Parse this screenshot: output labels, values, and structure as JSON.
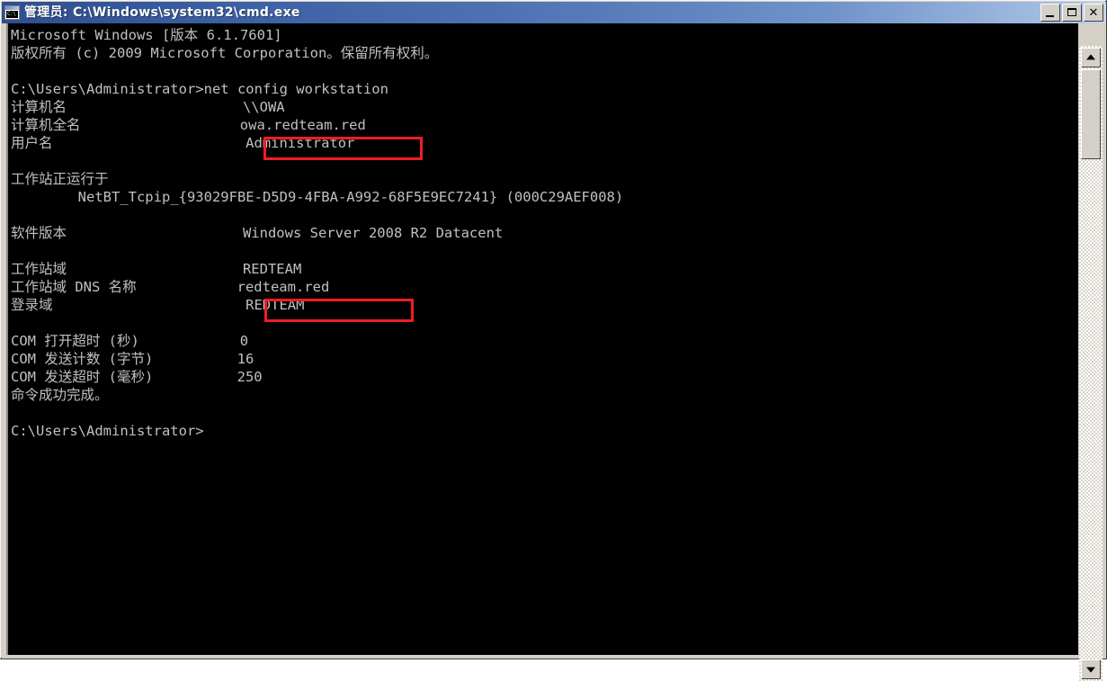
{
  "window": {
    "title": "管理员: C:\\Windows\\system32\\cmd.exe",
    "icon_name": "cmd-console-icon",
    "icon_text": "C:\\",
    "buttons": {
      "minimize": "_",
      "maximize": "□",
      "close": "✕"
    }
  },
  "colors": {
    "title_gradient_start": "#2e4e8f",
    "title_gradient_end": "#c7d6eb",
    "console_bg": "#000000",
    "console_fg": "#c0c0c0",
    "frame": "#d4d0c8",
    "highlight_red": "#f01c24"
  },
  "console": {
    "lines": [
      "Microsoft Windows [版本 6.1.7601]",
      "版权所有 (c) 2009 Microsoft Corporation。保留所有权利。",
      "",
      "C:\\Users\\Administrator>net config workstation",
      "计算机名                     \\\\OWA",
      "计算机全名                   owa.redteam.red",
      "用户名                       Administrator",
      "",
      "工作站正运行于",
      "        NetBT_Tcpip_{93029FBE-D5D9-4FBA-A992-68F5E9EC7241} (000C29AEF008)",
      "",
      "软件版本                     Windows Server 2008 R2 Datacent",
      "",
      "工作站域                     REDTEAM",
      "工作站域 DNS 名称            redteam.red",
      "登录域                       REDTEAM",
      "",
      "COM 打开超时 (秒)            0",
      "COM 发送计数 (字节)          16",
      "COM 发送超时 (毫秒)          250",
      "命令成功完成。",
      "",
      "C:\\Users\\Administrator>"
    ],
    "banner_version": "Microsoft Windows [版本 6.1.7601]",
    "copyright": "版权所有 (c) 2009 Microsoft Corporation。保留所有权利。",
    "prompt_path": "C:\\Users\\Administrator>",
    "command": "net config workstation",
    "fields": [
      {
        "label": "计算机名",
        "value": "\\\\OWA"
      },
      {
        "label": "计算机全名",
        "value": "owa.redteam.red",
        "highlighted": true
      },
      {
        "label": "用户名",
        "value": "Administrator"
      },
      {
        "label": "工作站正运行于",
        "value": "NetBT_Tcpip_{93029FBE-D5D9-4FBA-A992-68F5E9EC7241} (000C29AEF008)"
      },
      {
        "label": "软件版本",
        "value": "Windows Server 2008 R2 Datacent"
      },
      {
        "label": "工作站域",
        "value": "REDTEAM"
      },
      {
        "label": "工作站域 DNS 名称",
        "value": "redteam.red",
        "highlighted": true
      },
      {
        "label": "登录域",
        "value": "REDTEAM"
      },
      {
        "label": "COM 打开超时 (秒)",
        "value": "0"
      },
      {
        "label": "COM 发送计数 (字节)",
        "value": "16"
      },
      {
        "label": "COM 发送超时 (毫秒)",
        "value": "250"
      }
    ],
    "completion_message": "命令成功完成。",
    "final_prompt": "C:\\Users\\Administrator>"
  },
  "annotations": [
    {
      "name": "computer-full-name",
      "text": "owa.redteam.red"
    },
    {
      "name": "workstation-dns-name",
      "text": "redteam.red"
    }
  ],
  "scrollbar": {
    "up_arrow": "▲",
    "down_arrow": "▼"
  }
}
